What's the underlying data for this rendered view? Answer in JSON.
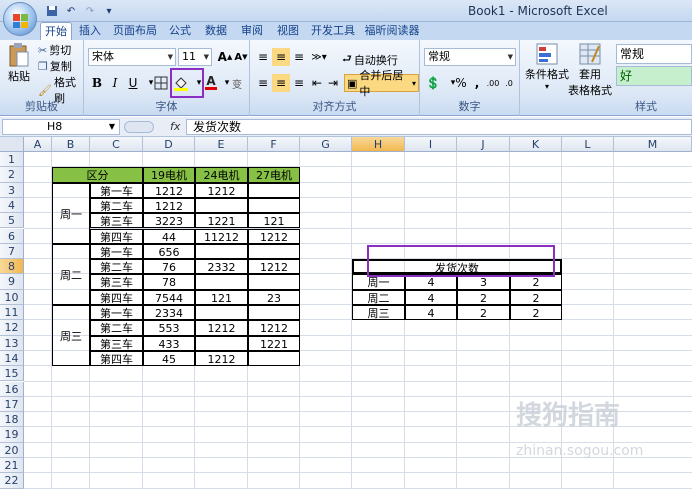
{
  "window": {
    "title": "Book1 - Microsoft Excel"
  },
  "tabs": [
    "开始",
    "插入",
    "页面布局",
    "公式",
    "数据",
    "审阅",
    "视图",
    "开发工具",
    "福昕阅读器"
  ],
  "ribbon": {
    "clipboard": {
      "paste": "粘贴",
      "cut": "剪切",
      "copy": "复制",
      "format_painter": "格式刷",
      "label": "剪贴板"
    },
    "font": {
      "name": "宋体",
      "size": "11",
      "bold": "B",
      "italic": "I",
      "underline": "U",
      "label": "字体"
    },
    "alignment": {
      "wrap": "自动换行",
      "merge": "合并后居中",
      "label": "对齐方式"
    },
    "number": {
      "format": "常规",
      "percent": "%",
      "comma": ",",
      "label": "数字"
    },
    "styles": {
      "conditional": "条件格式",
      "table_fmt1": "套用",
      "table_fmt2": "表格格式",
      "style_normal": "常规",
      "style_good": "好",
      "label": "样式"
    }
  },
  "formula_bar": {
    "name_box": "H8",
    "fx": "fx",
    "content": "发货次数"
  },
  "columns": [
    "A",
    "B",
    "C",
    "D",
    "E",
    "F",
    "G",
    "H",
    "I",
    "J",
    "K",
    "L",
    "M"
  ],
  "rows": [
    "1",
    "2",
    "3",
    "4",
    "5",
    "6",
    "7",
    "8",
    "9",
    "10",
    "11",
    "12",
    "13",
    "14",
    "15",
    "16",
    "17",
    "18",
    "19",
    "20",
    "21",
    "22"
  ],
  "table1": {
    "header": [
      "区分",
      "19电机",
      "24电机",
      "27电机"
    ],
    "groups": [
      {
        "label": "周一",
        "rows": [
          [
            "第一车",
            "1212",
            "1212",
            ""
          ],
          [
            "第二车",
            "1212",
            "",
            ""
          ],
          [
            "第三车",
            "3223",
            "1221",
            "121"
          ],
          [
            "第四车",
            "44",
            "11212",
            "1212"
          ]
        ]
      },
      {
        "label": "周二",
        "rows": [
          [
            "第一车",
            "656",
            "",
            ""
          ],
          [
            "第二车",
            "76",
            "2332",
            "1212"
          ],
          [
            "第三车",
            "78",
            "",
            ""
          ],
          [
            "第四车",
            "7544",
            "121",
            "23"
          ]
        ]
      },
      {
        "label": "周三",
        "rows": [
          [
            "第一车",
            "2334",
            "",
            ""
          ],
          [
            "第二车",
            "553",
            "1212",
            "1212"
          ],
          [
            "第三车",
            "433",
            "",
            "1221"
          ],
          [
            "第四车",
            "45",
            "1212",
            ""
          ]
        ]
      }
    ]
  },
  "table2": {
    "title": "发货次数",
    "rows": [
      [
        "周一",
        "4",
        "3",
        "2"
      ],
      [
        "周二",
        "4",
        "2",
        "2"
      ],
      [
        "周三",
        "4",
        "2",
        "2"
      ]
    ]
  },
  "watermark": {
    "line1": "搜狗指南",
    "line2": "zhinan.sogou.com"
  }
}
